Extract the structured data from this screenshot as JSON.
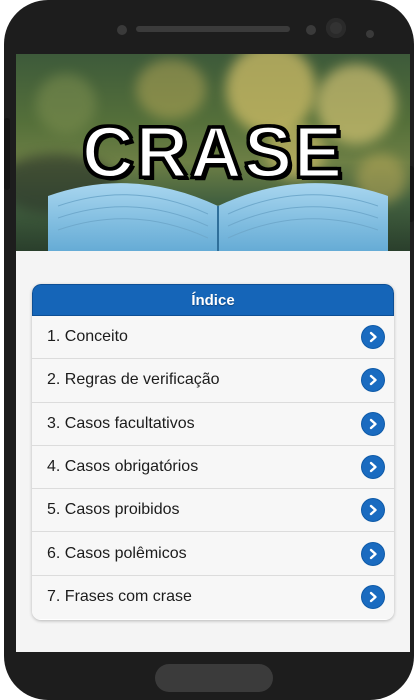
{
  "banner": {
    "title": "CRASE"
  },
  "index": {
    "title": "Índice",
    "items": [
      {
        "label": "1. Conceito"
      },
      {
        "label": "2. Regras de verificação"
      },
      {
        "label": "3. Casos facultativos"
      },
      {
        "label": "4. Casos obrigatórios"
      },
      {
        "label": "5. Casos proibidos"
      },
      {
        "label": "6. Casos polêmicos"
      },
      {
        "label": "7. Frases com crase"
      }
    ]
  },
  "colors": {
    "accent": "#1565b8",
    "chevron": "#1a6bc0"
  },
  "icons": {
    "item_arrow": "chevron-right-icon"
  }
}
